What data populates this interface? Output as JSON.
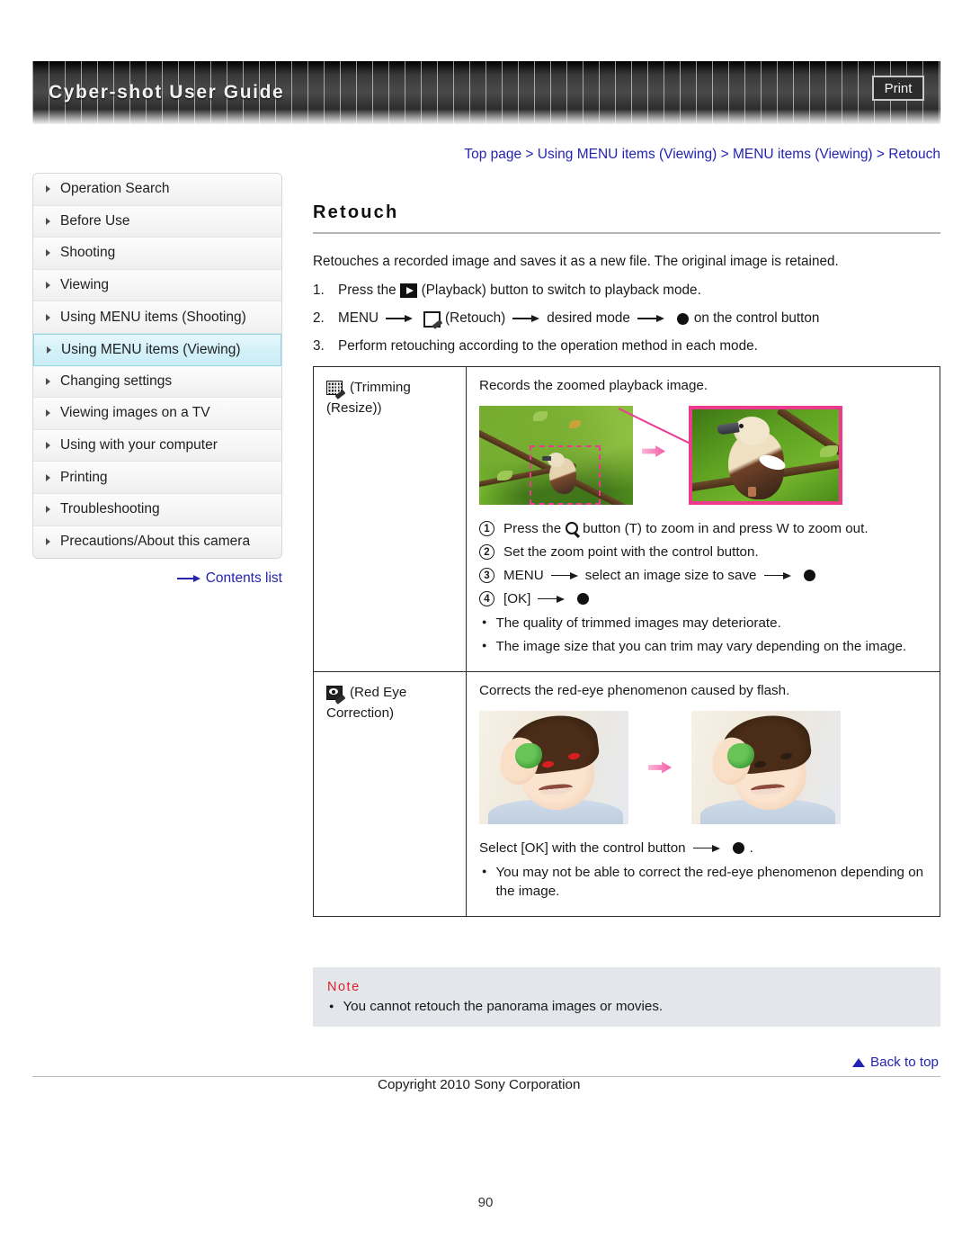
{
  "header": {
    "title": "Cyber-shot User Guide",
    "print_label": "Print"
  },
  "breadcrumb": {
    "text": "Top page > Using MENU items (Viewing) > MENU items (Viewing) > Retouch"
  },
  "sidebar": {
    "items": [
      {
        "label": "Operation Search",
        "active": false
      },
      {
        "label": "Before Use",
        "active": false
      },
      {
        "label": "Shooting",
        "active": false
      },
      {
        "label": "Viewing",
        "active": false
      },
      {
        "label": "Using MENU items (Shooting)",
        "active": false
      },
      {
        "label": "Using MENU items (Viewing)",
        "active": true
      },
      {
        "label": "Changing settings",
        "active": false
      },
      {
        "label": "Viewing images on a TV",
        "active": false
      },
      {
        "label": "Using with your computer",
        "active": false
      },
      {
        "label": "Printing",
        "active": false
      },
      {
        "label": "Troubleshooting",
        "active": false
      },
      {
        "label": "Precautions/About this camera",
        "active": false
      }
    ],
    "contents_list_label": "Contents list"
  },
  "main": {
    "title": "Retouch",
    "lead": "Retouches a recorded image and saves it as a new file. The original image is retained.",
    "steps": [
      {
        "number": "1.",
        "before_icon": "Press the",
        "icon": "playback-icon",
        "after_icon": "(Playback) button to switch to playback mode."
      },
      {
        "number": "2.",
        "part1": "MENU",
        "icon": "retouch-icon",
        "part2": "(Retouch)",
        "part3": "desired mode",
        "part4": "on the control button"
      },
      {
        "number": "3.",
        "text": "Perform retouching according to the operation method in each mode."
      }
    ]
  },
  "modes_table": {
    "rows": [
      {
        "label_icon": "trimming-icon",
        "label_line1": "(Trimming",
        "label_line2": "(Resize))",
        "caption": "Records the zoomed playback image.",
        "substeps": [
          {
            "num": "1",
            "before_icon": "Press the",
            "icon": "zoom-icon",
            "after_icon": "button (T) to zoom in and press W to zoom out."
          },
          {
            "num": "2",
            "text": "Set the zoom point with the control button."
          },
          {
            "num": "3",
            "part1": "MENU",
            "part2": "select an image size to save",
            "has_dot": true
          },
          {
            "num": "4",
            "part1": "[OK]",
            "has_dot": true
          }
        ],
        "bullets": [
          "The quality of trimmed images may deteriorate.",
          "The image size that you can trim may vary depending on the image."
        ]
      },
      {
        "label_icon": "red-eye-icon",
        "label_line1": "(Red Eye",
        "label_line2": "Correction)",
        "caption": "Corrects the red-eye phenomenon caused by flash.",
        "footer_text_before": "Select [OK] with the control button",
        "footer_text_after": ".",
        "bullets": [
          "You may not be able to correct the red-eye phenomenon depending on the image."
        ]
      }
    ]
  },
  "note": {
    "title": "Note",
    "items": [
      "You cannot retouch the panorama images or movies."
    ]
  },
  "footer": {
    "back_to_top": "Back to top",
    "copyright": "Copyright 2010 Sony Corporation",
    "page_number": "90"
  },
  "colors": {
    "link_blue": "#2424b0",
    "note_red": "#d9232a",
    "highlight_cyan": "#d2f0f8",
    "accent_pink": "#ee3a8c"
  }
}
